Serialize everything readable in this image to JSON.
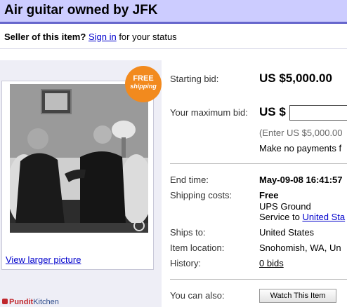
{
  "header": {
    "title": "Air guitar owned by JFK"
  },
  "seller": {
    "prefix": "Seller of this item?",
    "link": "Sign in",
    "suffix": "for your status"
  },
  "image_panel": {
    "view_larger": "View larger picture"
  },
  "badge": {
    "line1": "FREE",
    "line2": "shipping",
    "color": "#f28a1e"
  },
  "bid": {
    "starting_label": "Starting bid:",
    "starting_value": "US $5,000.00",
    "max_label": "Your maximum bid:",
    "max_prefix": "US $",
    "max_value": "",
    "hint": "(Enter US $5,000.00",
    "no_payments": "Make no payments f"
  },
  "info": {
    "end_time_label": "End time:",
    "end_time_value": "May-09-08 16:41:57",
    "shipping_label": "Shipping costs:",
    "shipping_value": "Free",
    "shipping_method": "UPS Ground",
    "service_prefix": "Service to",
    "service_link": "United Sta",
    "ships_to_label": "Ships to:",
    "ships_to_value": "United States",
    "location_label": "Item location:",
    "location_value": "Snohomish, WA, Un",
    "history_label": "History:",
    "history_value": "0 bids"
  },
  "actions": {
    "also_label": "You can also:",
    "watch_button": "Watch This Item"
  },
  "watermark": {
    "part1": "Pundit",
    "part2": "Kitchen"
  },
  "colors": {
    "title_bg": "#ccccff",
    "title_border": "#6666cc",
    "link": "#0000cc"
  }
}
